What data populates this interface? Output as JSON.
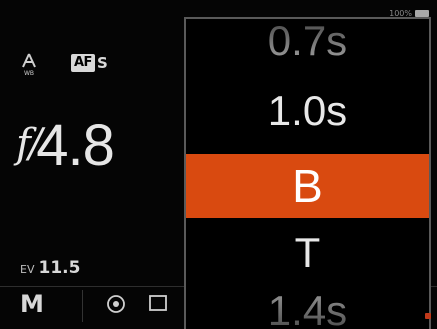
{
  "status": {
    "battery_text": "100%"
  },
  "left_panel": {
    "white_balance_icon": "auto-white-balance-icon",
    "focus_mode": {
      "badge": "AF",
      "mode": "S"
    },
    "aperture": {
      "prefix": "f/",
      "value": "4.8"
    },
    "exposure_value": {
      "key": "EV",
      "value": "11.5"
    }
  },
  "bottom_bar": {
    "exposure_mode": "M",
    "metering_icon": "matrix-metering-icon",
    "drive_icon": "single-shot-drive-icon"
  },
  "shutter_picker": {
    "items": [
      {
        "label": "0.7s",
        "state": "partial-top"
      },
      {
        "label": "1.0s",
        "state": "normal"
      },
      {
        "label": "B",
        "state": "selected"
      },
      {
        "label": "T",
        "state": "normal"
      },
      {
        "label": "1.4s",
        "state": "partial-bottom"
      }
    ],
    "selected_index": 2,
    "accent_color": "#d94a10"
  }
}
